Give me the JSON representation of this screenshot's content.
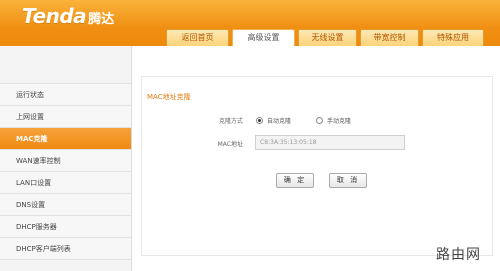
{
  "brand": {
    "logo_text": "Tenda",
    "logo_cn": "腾达"
  },
  "nav": {
    "tabs": [
      {
        "label": "返回首页"
      },
      {
        "label": "高级设置"
      },
      {
        "label": "无线设置"
      },
      {
        "label": "带宽控制"
      },
      {
        "label": "特殊应用"
      }
    ],
    "active_index": 1
  },
  "sidebar": {
    "items": [
      {
        "label": "运行状态"
      },
      {
        "label": "上网设置"
      },
      {
        "label": "MAC克隆"
      },
      {
        "label": "WAN速率控制"
      },
      {
        "label": "LAN口设置"
      },
      {
        "label": "DNS设置"
      },
      {
        "label": "DHCP服务器"
      },
      {
        "label": "DHCP客户端列表"
      }
    ],
    "active_index": 2
  },
  "main": {
    "section_title": "MAC地址克隆",
    "clone_mode": {
      "label": "克隆方式",
      "options": [
        {
          "label": "自动克隆",
          "checked": true
        },
        {
          "label": "手动克隆",
          "checked": false
        }
      ]
    },
    "mac_address": {
      "label": "MAC地址",
      "value": "C8:3A:35:13:05:18"
    },
    "buttons": {
      "ok_label": "确 定",
      "cancel_label": "取 消"
    }
  },
  "watermark": {
    "text": "路由网"
  },
  "colors": {
    "accent": "#f0901a",
    "title_text": "#e07a10"
  }
}
